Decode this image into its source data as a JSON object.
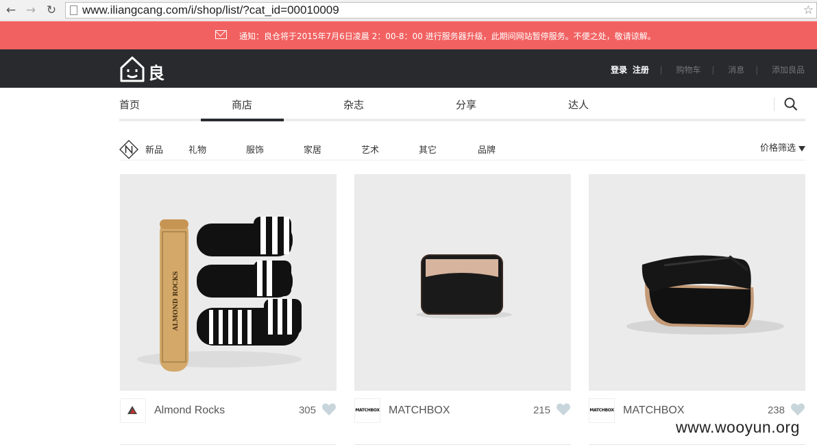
{
  "browser": {
    "url": "www.iliangcang.com/i/shop/list/?cat_id=00010009"
  },
  "notice": {
    "text": "通知：良仓将于2015年7月6日凌晨 2：00-8：00 进行服务器升级，此期间网站暂停服务。不便之处，敬请谅解。"
  },
  "header": {
    "logo_text": "良仓",
    "login": "登录",
    "register": "注册",
    "cart": "购物车",
    "messages": "消息",
    "add_item": "添加良品",
    "separator": "|"
  },
  "main_nav": {
    "items": [
      {
        "label": "首页"
      },
      {
        "label": "商店"
      },
      {
        "label": "杂志"
      },
      {
        "label": "分享"
      },
      {
        "label": "达人"
      }
    ],
    "active": "商店"
  },
  "sub_nav": {
    "items": [
      {
        "label": "新品"
      },
      {
        "label": "礼物"
      },
      {
        "label": "服饰"
      },
      {
        "label": "家居"
      },
      {
        "label": "艺术"
      },
      {
        "label": "其它"
      },
      {
        "label": "品牌"
      }
    ],
    "price_filter": "价格筛选"
  },
  "products": [
    {
      "brand": "Almond Rocks",
      "likes": "305",
      "sock_label": "ALMOND ROCKS"
    },
    {
      "brand": "MATCHBOX",
      "likes": "215",
      "logo_text": "MATCHBOX"
    },
    {
      "brand": "MATCHBOX",
      "likes": "238",
      "logo_text": "MATCHBOX"
    }
  ],
  "watermark": "www.wooyun.org",
  "colors": {
    "notice_bg": "#f26161",
    "header_bg": "#282a2e",
    "heart": "#c8d6dc"
  }
}
